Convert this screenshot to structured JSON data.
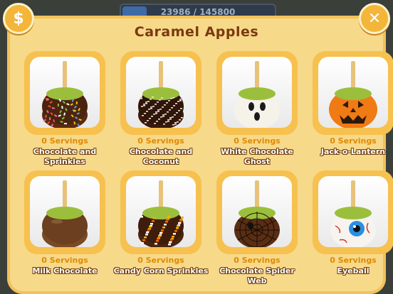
{
  "progress": {
    "text": "23986 / 145800",
    "fraction": 0.16
  },
  "header": {
    "title": "Caramel Apples",
    "coin_icon": "$",
    "close_icon": "✕"
  },
  "items": [
    {
      "servings": "0 Servings",
      "name": "Chocolate and Sprinkles",
      "style": "sprinkles"
    },
    {
      "servings": "0 Servings",
      "name": "Chocolate and Coconut",
      "style": "coconut"
    },
    {
      "servings": "0 Servings",
      "name": "White Chocolate Ghost",
      "style": "ghost"
    },
    {
      "servings": "0 Servings",
      "name": "Jack-o-Lantern",
      "style": "pumpkin"
    },
    {
      "servings": "0 Servings",
      "name": "Milk Chocolate",
      "style": "milk"
    },
    {
      "servings": "0 Servings",
      "name": "Candy Corn Sprinkles",
      "style": "candycorn"
    },
    {
      "servings": "0 Servings",
      "name": "Chocolate Spider Web",
      "style": "spider"
    },
    {
      "servings": "0 Servings",
      "name": "Eyeball",
      "style": "eyeball"
    }
  ],
  "colors": {
    "panel": "#f7d98a",
    "card": "#f6c14f",
    "title": "#7a3a10",
    "servings": "#e08a00"
  }
}
